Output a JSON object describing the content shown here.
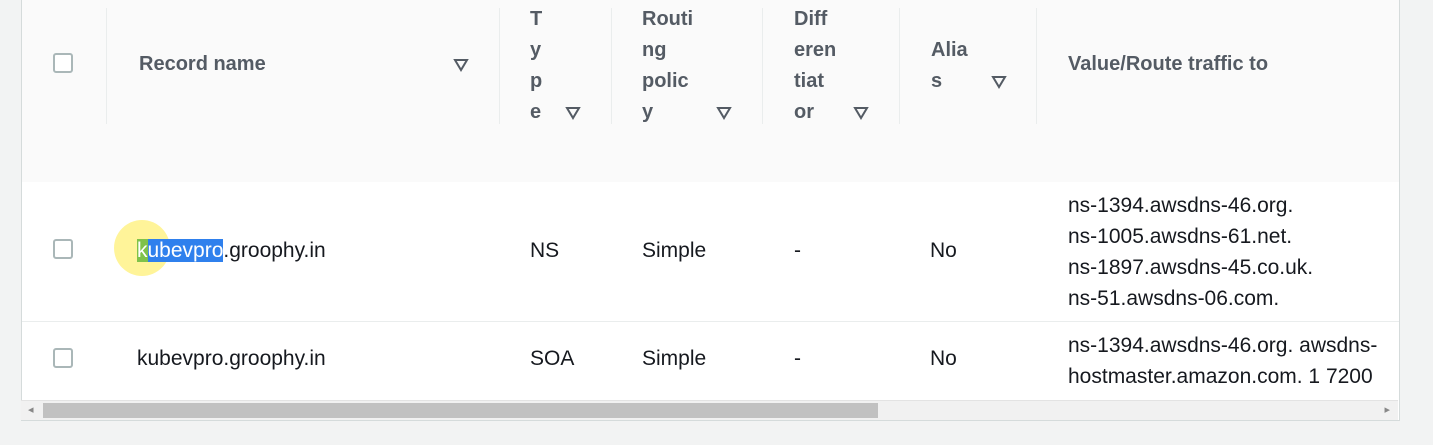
{
  "table": {
    "headers": {
      "record_name": "Record name",
      "type": "T\ny\np\ne",
      "routing_policy": "Routi\nng\npolic\ny",
      "differentiator": "Diff\neren\ntiat\nor",
      "alias": "Alia\ns",
      "value": "Value/Route traffic to"
    },
    "rows": [
      {
        "record_name_selected_first": "k",
        "record_name_selected_rest": "ubevpro",
        "record_name_rest": ".groophy.in",
        "type": "NS",
        "routing_policy": "Simple",
        "differentiator": "-",
        "alias": "No",
        "values": [
          "ns-1394.awsdns-46.org.",
          "ns-1005.awsdns-61.net.",
          "ns-1897.awsdns-45.co.uk.",
          "ns-51.awsdns-06.com."
        ]
      },
      {
        "record_name": "kubevpro.groophy.in",
        "type": "SOA",
        "routing_policy": "Simple",
        "differentiator": "-",
        "alias": "No",
        "values": [
          "ns-1394.awsdns-46.org. awsdns-",
          "hostmaster.amazon.com. 1 7200"
        ]
      }
    ]
  },
  "scrollbar": {
    "left_arrow": "◂",
    "right_arrow": "▸"
  },
  "colors": {
    "selection": "#2f80ed",
    "header_bg": "#fafafa",
    "border": "#eaeded"
  }
}
